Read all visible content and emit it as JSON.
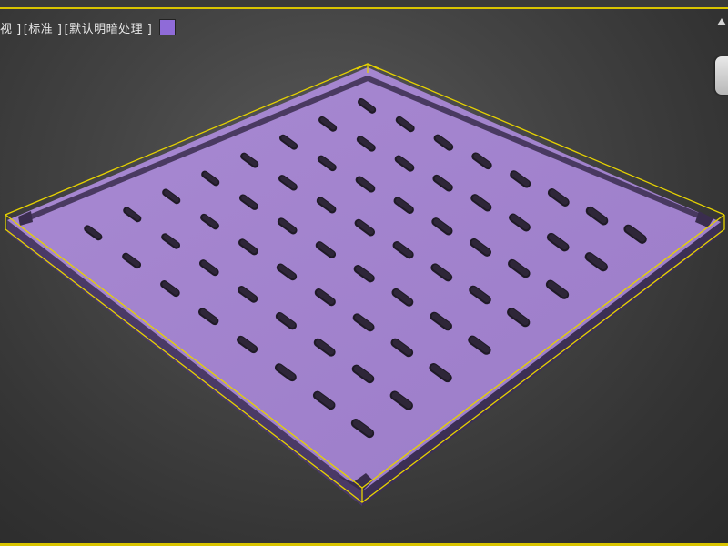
{
  "viewport": {
    "label_segments": [
      "视 ]",
      "[标准 ]",
      "[默认明暗处理 ]"
    ],
    "swatch_color": "#8f6bd8"
  },
  "scene": {
    "object_color": "#a484cf",
    "selection_color": "#e6d200",
    "hole_color": "#1f1a26",
    "icons": [
      "viewcube-icon",
      "home-icon"
    ]
  }
}
